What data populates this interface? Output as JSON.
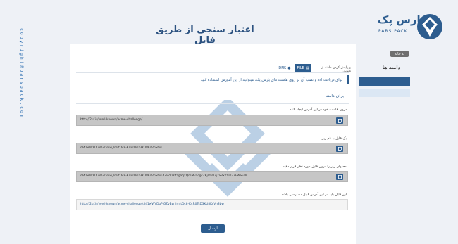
{
  "brand": {
    "logo_fa": "پارس پک",
    "logo_en": "PARS PACK",
    "copyright": "copyright@parspack.com"
  },
  "page": {
    "title": "اعتبار سنجی از طریق فایل"
  },
  "sidebar": {
    "breadcrumb": "خانه",
    "title": "دامنه ها"
  },
  "tabs": {
    "prefix_text": "ویرایش کردن دامنه از طریق:",
    "items": [
      {
        "label": "FILE",
        "icon": "file-icon",
        "active": true
      },
      {
        "label": "DNS",
        "icon": "globe-icon",
        "active": false
      }
    ]
  },
  "instruction": "برای دریافت ssl و نصب آن بر روی هاست های پارس پک، میتوانید از این آموزش استفاده کنید",
  "section": {
    "title": "برای دامنه"
  },
  "steps": [
    {
      "label": "درون هاست خود در این آدرس ایجاد کنید",
      "value": "http://2uf.ir/.well-known/acme-challenge/"
    },
    {
      "label": "یک فایل با نام زیر",
      "value": "dI41wWYDuPiGZvBw_lmrtDc8-K4R0TsD3KU8KcVnSbw"
    },
    {
      "label": "محتوای زیر را درون فایل مورد نظر قرار دهید",
      "value": "dI41wWYDuPiGZvBw_lmrtDc8-K4R0TsD3KU8KcVnSbw.dZRd08ftzgaqXQmMvacgcZKjlmsTq1SRxZSI027FWSFrM"
    },
    {
      "label": "این فایل باید در این آدرس قابل دسترسی باشد",
      "value": "http://2uf.ir/.well-known/acme-challenge/dI41wWYDuPiGZvBw_lmrtDc8-K4R0TsD3KU8KcVnSbw"
    }
  ],
  "submit_label": "ارسال",
  "colors": {
    "brand": "#2d5d8f",
    "background": "#eef1f6",
    "field_dark": "#c6c6c6",
    "field_light": "#f4f4f4"
  }
}
